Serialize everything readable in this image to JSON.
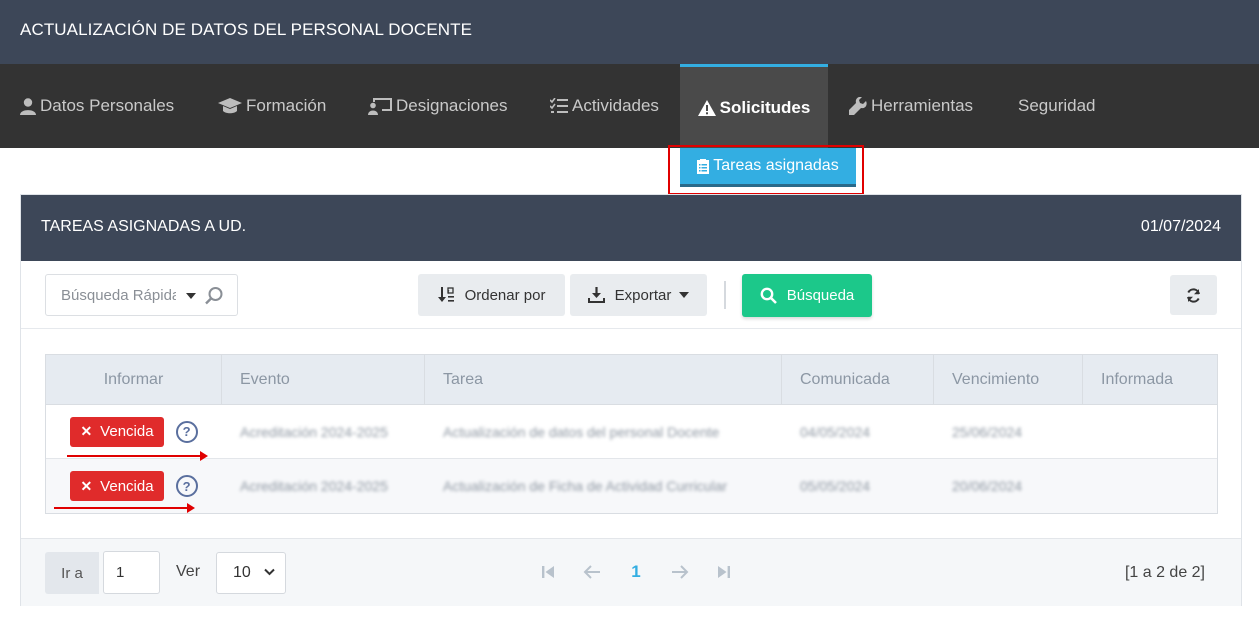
{
  "header": {
    "title": "ACTUALIZACIÓN DE DATOS DEL PERSONAL DOCENTE"
  },
  "nav": {
    "items": [
      {
        "label": "Datos Personales",
        "icon": "user-icon"
      },
      {
        "label": "Formación",
        "icon": "graduation-cap-icon"
      },
      {
        "label": "Designaciones",
        "icon": "chalkboard-teacher-icon"
      },
      {
        "label": "Actividades",
        "icon": "tasks-icon"
      },
      {
        "label": "Solicitudes",
        "icon": "warning-icon",
        "active": true
      },
      {
        "label": "Herramientas",
        "icon": "wrench-icon"
      },
      {
        "label": "Seguridad",
        "icon": ""
      }
    ],
    "sub_item": {
      "label": "Tareas asignadas",
      "icon": "clipboard-icon"
    }
  },
  "panel": {
    "title": "TAREAS ASIGNADAS A UD.",
    "date": "01/07/2024"
  },
  "toolbar": {
    "quick_search_placeholder": "Búsqueda Rápida",
    "sort_label": "Ordenar por",
    "export_label": "Exportar",
    "search_label": "Búsqueda"
  },
  "table": {
    "columns": [
      "Informar",
      "Evento",
      "Tarea",
      "Comunicada",
      "Vencimiento",
      "Informada"
    ],
    "rows": [
      {
        "status": "Vencida",
        "evento": "Acreditación 2024-2025",
        "tarea": "Actualización de datos del personal Docente",
        "comunicada": "04/05/2024",
        "vencimiento": "25/06/2024",
        "informada": ""
      },
      {
        "status": "Vencida",
        "evento": "Acreditación 2024-2025",
        "tarea": "Actualización de Ficha de Actividad Curricular",
        "comunicada": "05/05/2024",
        "vencimiento": "20/06/2024",
        "informada": ""
      }
    ]
  },
  "footer": {
    "goto_label": "Ir a",
    "goto_value": "1",
    "ver_label": "Ver",
    "page_size": "10",
    "current_page": "1",
    "range_text": "[1 a 2 de 2]"
  },
  "colors": {
    "header_bg": "#3d4758",
    "nav_bg": "#333333",
    "accent": "#33aee2",
    "success": "#1cc88a",
    "danger": "#e02b2b"
  }
}
